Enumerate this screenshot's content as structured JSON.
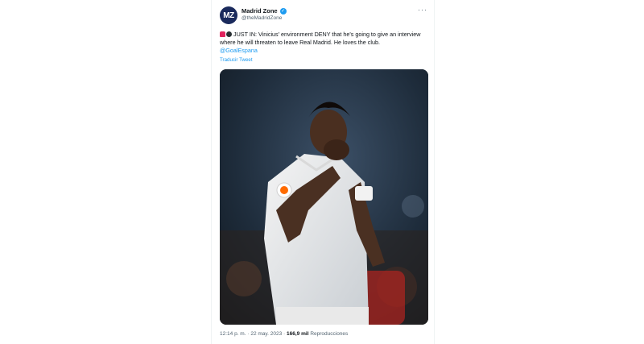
{
  "account": {
    "avatar_text": "MZ",
    "name": "Madrid Zone",
    "handle": "@theMadridZone"
  },
  "tweet": {
    "emoji": [
      "police-light-icon",
      "bomb-icon"
    ],
    "text": "JUST IN: Vinicius' environment DENY that he's going to give an interview where he will threaten to leave Real Madrid. He loves the club.",
    "mention": "@GoalEspana",
    "translate_link": "Traducir Tweet",
    "photo_alt": "Football player in white kit kissing his badge"
  },
  "meta": {
    "time": "12:14 p. m.",
    "separator": "·",
    "date": "22 may. 2023",
    "views": "166,9 mil",
    "views_label": "Reproducciones"
  },
  "colors": {
    "link": "#1d9bf0",
    "verified": "#1d9bf0",
    "avatar_bg": "#1a2a5c",
    "secondary_text": "#536471"
  }
}
